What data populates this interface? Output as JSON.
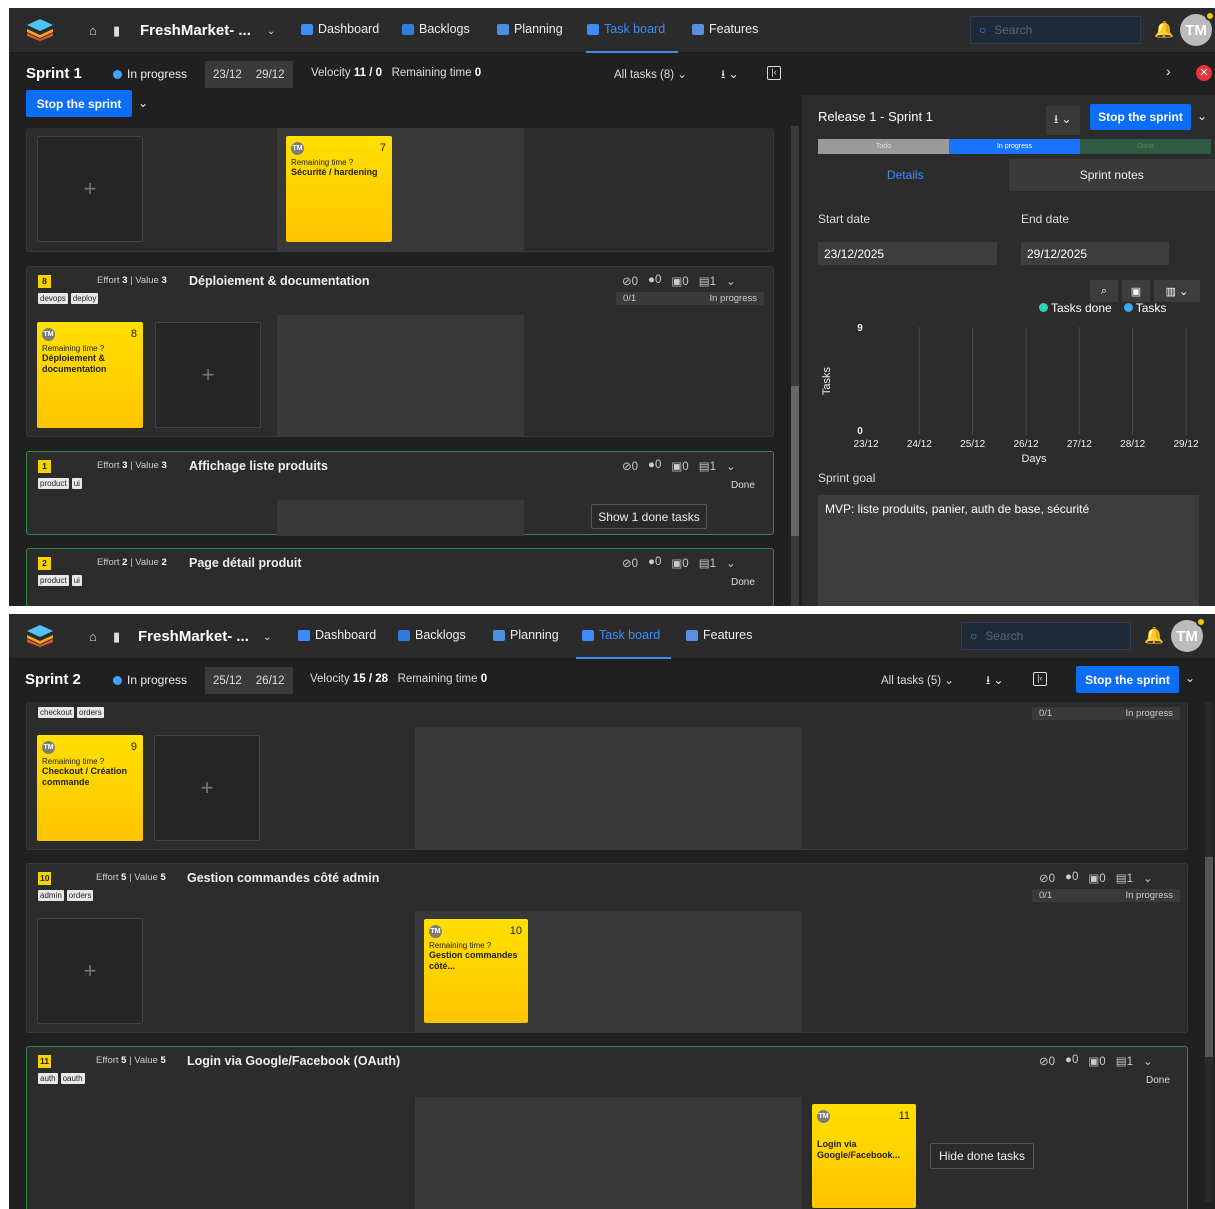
{
  "top": {
    "nav": {
      "project": "FreshMarket- ...",
      "dashboard": "Dashboard",
      "backlogs": "Backlogs",
      "planning": "Planning",
      "taskboard": "Task board",
      "features": "Features",
      "search_placeholder": "Search",
      "avatar": "TM"
    },
    "bar": {
      "sprint": "Sprint 1",
      "status": "In progress",
      "start": "23/12",
      "end": "29/12",
      "velocity_label": "Velocity",
      "velocity": "11 / 0",
      "remaining_label": "Remaining time",
      "remaining": "0",
      "all_tasks": "All tasks (8)",
      "stop": "Stop the sprint"
    },
    "stories": [
      {
        "id": "8",
        "effort": "3",
        "value": "3",
        "title": "Déploiement & documentation",
        "tags": [
          "devops",
          "deploy"
        ],
        "attach": "0",
        "comments": "0",
        "tasks_count": "0",
        "subs": "1",
        "progress": "0/1",
        "status": "In progress",
        "card": {
          "num": "8",
          "remaining": "Remaining time ?",
          "title": "Déploiement & documentation"
        }
      },
      {
        "id": "1",
        "effort": "3",
        "value": "3",
        "title": "Affichage liste produits",
        "tags": [
          "product",
          "ui"
        ],
        "attach": "0",
        "comments": "0",
        "tasks_count": "0",
        "subs": "1",
        "status": "Done",
        "button": "Show 1 done tasks"
      },
      {
        "id": "2",
        "effort": "2",
        "value": "2",
        "title": "Page détail produit",
        "tags": [
          "product",
          "ui"
        ],
        "attach": "0",
        "comments": "0",
        "tasks_count": "0",
        "subs": "1",
        "status": "Done"
      }
    ],
    "card_top": {
      "num": "7",
      "remaining": "Remaining time ?",
      "title": "Sécurité / hardening"
    },
    "effort_label": "Effort",
    "value_label": "Value",
    "side": {
      "release": "Release 1 - Sprint 1",
      "stop": "Stop the sprint",
      "seg_todo": "Todo",
      "seg_progress": "In progress",
      "seg_done": "Done",
      "tab_details": "Details",
      "tab_notes": "Sprint notes",
      "start_label": "Start date",
      "end_label": "End date",
      "start": "23/12/2025",
      "end": "29/12/2025",
      "legend_done": "Tasks done",
      "legend_tasks": "Tasks",
      "goal_label": "Sprint goal",
      "goal": "MVP: liste produits, panier, auth de base, sécurité"
    },
    "chart_data": {
      "type": "line",
      "x": [
        "23/12",
        "24/12",
        "25/12",
        "26/12",
        "27/12",
        "28/12",
        "29/12"
      ],
      "series": [
        {
          "name": "Tasks done",
          "values": []
        },
        {
          "name": "Tasks",
          "values": []
        }
      ],
      "xlabel": "Days",
      "ylabel": "Tasks",
      "ylim": [
        0,
        9
      ],
      "yticks": [
        "0",
        "9"
      ],
      "colors": {
        "Tasks done": "#2ed3b7",
        "Tasks": "#39a9f5"
      }
    }
  },
  "bottom": {
    "nav": {
      "project": "FreshMarket- ...",
      "dashboard": "Dashboard",
      "backlogs": "Backlogs",
      "planning": "Planning",
      "taskboard": "Task board",
      "features": "Features",
      "search_placeholder": "Search",
      "avatar": "TM"
    },
    "bar": {
      "sprint": "Sprint 2",
      "status": "In progress",
      "start": "25/12",
      "end": "26/12",
      "velocity_label": "Velocity",
      "velocity": "15 / 28",
      "remaining_label": "Remaining time",
      "remaining": "0",
      "all_tasks": "All tasks (5)",
      "stop": "Stop the sprint"
    },
    "first": {
      "tags": [
        "checkout",
        "orders"
      ],
      "progress": "0/1",
      "status": "In progress",
      "card": {
        "num": "9",
        "remaining": "Remaining time ?",
        "title": "Checkout / Création commande"
      }
    },
    "stories": [
      {
        "id": "10",
        "effort": "5",
        "value": "5",
        "title": "Gestion commandes côté admin",
        "tags": [
          "admin",
          "orders"
        ],
        "attach": "0",
        "comments": "0",
        "tasks_count": "0",
        "subs": "1",
        "progress": "0/1",
        "status": "In progress",
        "card": {
          "num": "10",
          "remaining": "Remaining time ?",
          "title": "Gestion commandes côté..."
        }
      },
      {
        "id": "11",
        "effort": "5",
        "value": "5",
        "title": "Login via Google/Facebook (OAuth)",
        "tags": [
          "auth",
          "oauth"
        ],
        "attach": "0",
        "comments": "0",
        "tasks_count": "0",
        "subs": "1",
        "status": "Done",
        "button": "Hide done tasks",
        "card": {
          "num": "11",
          "title": "Login via Google/Facebook..."
        }
      }
    ]
  }
}
